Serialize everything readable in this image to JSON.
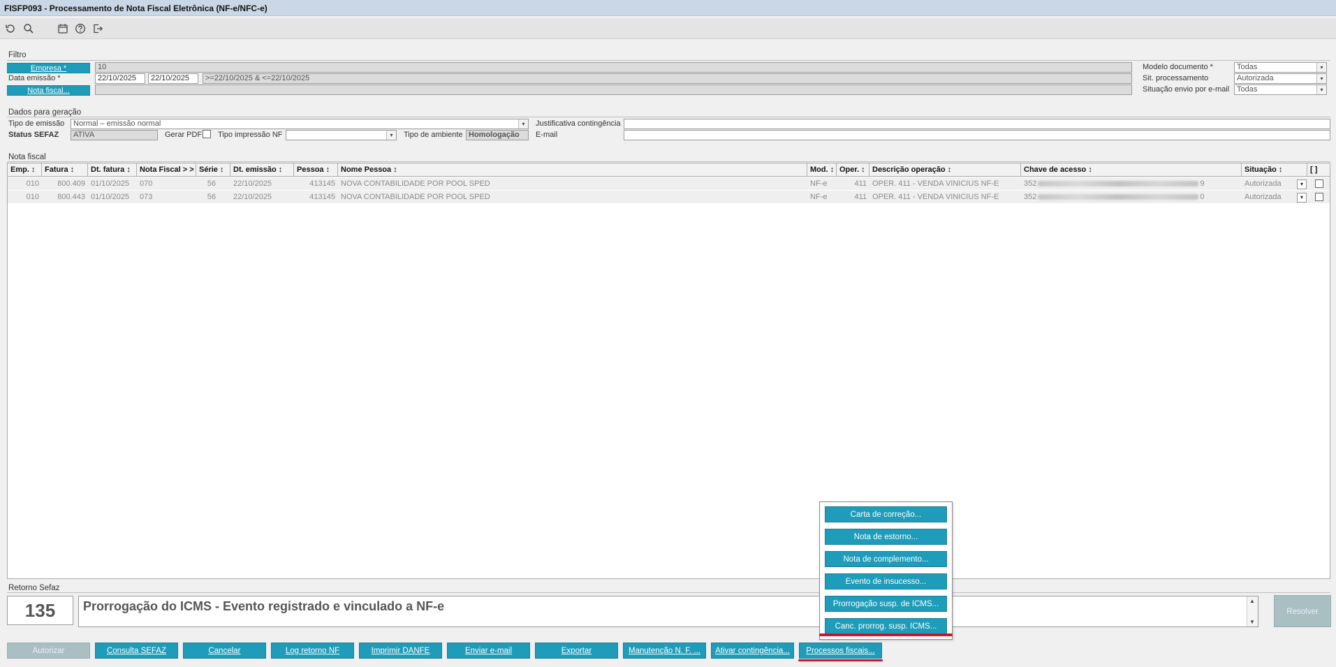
{
  "title": "FISFP093 - Processamento de Nota Fiscal Eletrônica (NF-e/NFC-e)",
  "toolbar": {
    "icons": [
      "refresh-icon",
      "search-icon",
      "calendar-icon",
      "help-icon",
      "exit-icon"
    ]
  },
  "filtro": {
    "section": "Filtro",
    "empresa_label": "Empresa *",
    "empresa_value": "10",
    "data_emissao_label": "Data emissão *",
    "data_inicio": "22/10/2025",
    "data_fim": "22/10/2025",
    "data_expr": ">=22/10/2025 & <=22/10/2025",
    "nota_fiscal_label": "Nota fiscal...",
    "nota_fiscal_value": "",
    "modelo_label": "Modelo documento *",
    "modelo_value": "Todas",
    "sit_proc_label": "Sit. processamento",
    "sit_proc_value": "Autorizada",
    "sit_email_label": "Situação envio por e-mail",
    "sit_email_value": "Todas"
  },
  "geracao": {
    "section": "Dados para geração",
    "tipo_emissao_label": "Tipo de emissão",
    "tipo_emissao_value": "Normal – emissão normal",
    "justificativa_label": "Justificativa contingência",
    "justificativa_value": "",
    "status_label": "Status SEFAZ",
    "status_value": "ATIVA",
    "gerar_pdf_label": "Gerar PDF",
    "tipo_impressao_label": "Tipo impressão NF",
    "tipo_impressao_value": "",
    "tipo_ambiente_label": "Tipo de ambiente",
    "tipo_ambiente_value": "Homologação",
    "email_label": "E-mail",
    "email_value": ""
  },
  "nota_fiscal": {
    "section": "Nota fiscal",
    "columns": [
      "Emp. ↕",
      "Fatura ↕",
      "Dt. fatura ↕",
      "Nota Fiscal > >",
      "Série ↕",
      "Dt. emissão ↕",
      "Pessoa ↕",
      "Nome Pessoa ↕",
      "Mod. ↕",
      "Oper. ↕",
      "Descrição operação ↕",
      "Chave de acesso ↕",
      "Situação ↕",
      "[ ]"
    ],
    "rows": [
      {
        "emp": "010",
        "fatura": "800.409",
        "dt_fatura": "01/10/2025",
        "nf": "070",
        "serie": "56",
        "dt_emissao": "22/10/2025",
        "pessoa": "413145",
        "nome": "NOVA CONTABILIDADE POR POOL SPED",
        "mod": "NF-e",
        "oper": "411",
        "desc": "OPER. 411 - VENDA VINICIUS NF-E",
        "chave_ini": "352",
        "chave_fim": "9",
        "situacao": "Autorizada"
      },
      {
        "emp": "010",
        "fatura": "800.443",
        "dt_fatura": "01/10/2025",
        "nf": "073",
        "serie": "56",
        "dt_emissao": "22/10/2025",
        "pessoa": "413145",
        "nome": "NOVA CONTABILIDADE POR POOL SPED",
        "mod": "NF-e",
        "oper": "411",
        "desc": "OPER. 411 - VENDA VINICIUS NF-E",
        "chave_ini": "352",
        "chave_fim": "0",
        "situacao": "Autorizada"
      }
    ]
  },
  "retorno": {
    "section": "Retorno Sefaz",
    "code": "135",
    "message": "Prorrogação do ICMS - Evento registrado e vinculado a NF-e",
    "resolver": "Resolver"
  },
  "buttons": {
    "autorizar": "Autorizar",
    "consulta": "Consulta SEFAZ",
    "cancelar": "Cancelar",
    "log": "Log retorno NF",
    "imprimir": "Imprimir DANFE",
    "email": "Enviar e-mail",
    "exportar": "Exportar",
    "manutencao": "Manutenção N. F. ...",
    "contingencia": "Ativar contingência...",
    "processos": "Processos fiscais..."
  },
  "popup": {
    "items": [
      "Carta de correção...",
      "Nota de estorno...",
      "Nota de complemento...",
      "Evento de insucesso...",
      "Prorrogação susp. de ICMS...",
      "Canc. prorrog. susp. ICMS..."
    ]
  },
  "colors": {
    "accent": "#1e9cb9",
    "highlight": "#d0132a",
    "title_bar": "#c9d7e6"
  }
}
